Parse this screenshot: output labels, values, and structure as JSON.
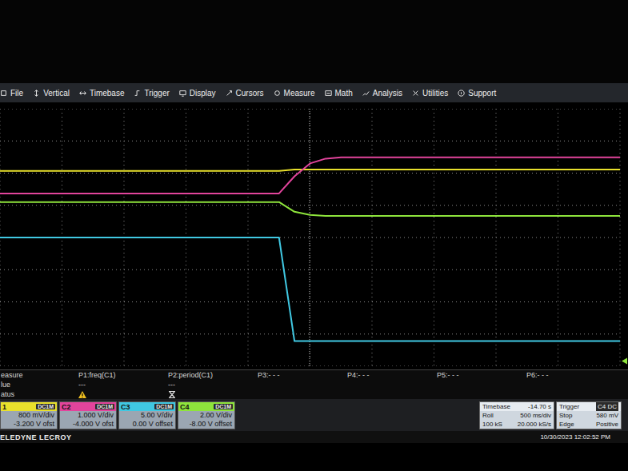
{
  "menu": [
    "File",
    "Vertical",
    "Timebase",
    "Trigger",
    "Display",
    "Cursors",
    "Measure",
    "Math",
    "Analysis",
    "Utilities",
    "Support"
  ],
  "channels": [
    {
      "name": "1",
      "coupling": "DC1M",
      "scale": "800 mV/div",
      "offset": "-3.200 V ofst",
      "color": "#e8e02c",
      "values": [
        2.07,
        2.07,
        2.07,
        2.07,
        2.07,
        2.07,
        2.07,
        2.07,
        2.07,
        2.07,
        2.07,
        2.07,
        2.07,
        2.07,
        2.07,
        2.07,
        2.07,
        2.07,
        2.07,
        2.11,
        2.11,
        2.11,
        2.11,
        2.11,
        2.11,
        2.11,
        2.11,
        2.11,
        2.11,
        2.11,
        2.11,
        2.11,
        2.11,
        2.11,
        2.11,
        2.11,
        2.11,
        2.11,
        2.11,
        2.11,
        2.11
      ]
    },
    {
      "name": "C2",
      "coupling": "DC1M",
      "scale": "1.000 V/div",
      "offset": "-4.000 V ofst",
      "color": "#e2449c",
      "values": [
        1.37,
        1.37,
        1.37,
        1.37,
        1.37,
        1.37,
        1.37,
        1.37,
        1.37,
        1.37,
        1.37,
        1.37,
        1.37,
        1.37,
        1.37,
        1.37,
        1.37,
        1.37,
        1.37,
        1.9,
        2.3,
        2.45,
        2.49,
        2.49,
        2.49,
        2.49,
        2.49,
        2.49,
        2.49,
        2.49,
        2.49,
        2.49,
        2.49,
        2.49,
        2.49,
        2.49,
        2.49,
        2.49,
        2.49,
        2.49,
        2.49
      ]
    },
    {
      "name": "C3",
      "coupling": "DC1M",
      "scale": "5.00 V/div",
      "offset": "0.00 V offset",
      "color": "#40c8e2",
      "values": [
        0,
        0,
        0,
        0,
        0,
        0,
        0,
        0,
        0,
        0,
        0,
        0,
        0,
        0,
        0,
        0,
        0,
        0,
        0,
        -3.22,
        -3.22,
        -3.22,
        -3.22,
        -3.22,
        -3.22,
        -3.22,
        -3.22,
        -3.22,
        -3.22,
        -3.22,
        -3.22,
        -3.22,
        -3.22,
        -3.22,
        -3.22,
        -3.22,
        -3.22,
        -3.22,
        -3.22,
        -3.22,
        -3.22
      ]
    },
    {
      "name": "C4",
      "coupling": "DC1M",
      "scale": "2.00 V/div",
      "offset": "-8.00 V offset",
      "color": "#8ee43c",
      "values": [
        1.1,
        1.1,
        1.1,
        1.1,
        1.1,
        1.1,
        1.1,
        1.1,
        1.1,
        1.1,
        1.1,
        1.1,
        1.1,
        1.1,
        1.1,
        1.1,
        1.1,
        1.1,
        1.1,
        0.8,
        0.7,
        0.67,
        0.67,
        0.67,
        0.67,
        0.67,
        0.67,
        0.67,
        0.67,
        0.67,
        0.67,
        0.67,
        0.67,
        0.67,
        0.67,
        0.67,
        0.67,
        0.67,
        0.67,
        0.67,
        0.67
      ]
    }
  ],
  "trigger_level": -3.84,
  "measure": {
    "row_labels": [
      "easure",
      "lue",
      "atus"
    ],
    "params": [
      {
        "label": "P1:freq(C1)",
        "value": "---",
        "status": "warning"
      },
      {
        "label": "P2:period(C1)",
        "value": "---",
        "status": "invalid"
      },
      {
        "label": "P3:- - -",
        "value": "",
        "status": "none"
      },
      {
        "label": "P4:- - -",
        "value": "",
        "status": "none"
      },
      {
        "label": "P5:- - -",
        "value": "",
        "status": "none"
      },
      {
        "label": "P6:- - -",
        "value": "",
        "status": "none"
      }
    ]
  },
  "timebase": {
    "title": "Timebase",
    "delay": "-14.70 s",
    "rows": [
      [
        "Roll",
        "500 ms/div"
      ],
      [
        "100 kS",
        "20.000 kS/s"
      ]
    ]
  },
  "trigger": {
    "title": "Trigger",
    "source": "C4 DC",
    "rows": [
      [
        "Stop",
        "580 mV"
      ],
      [
        "Edge",
        "Positive"
      ]
    ]
  },
  "footer": {
    "brand": "ELEDYNE LECROY",
    "timestamp": "10/30/2023 12:02:52 PM"
  }
}
